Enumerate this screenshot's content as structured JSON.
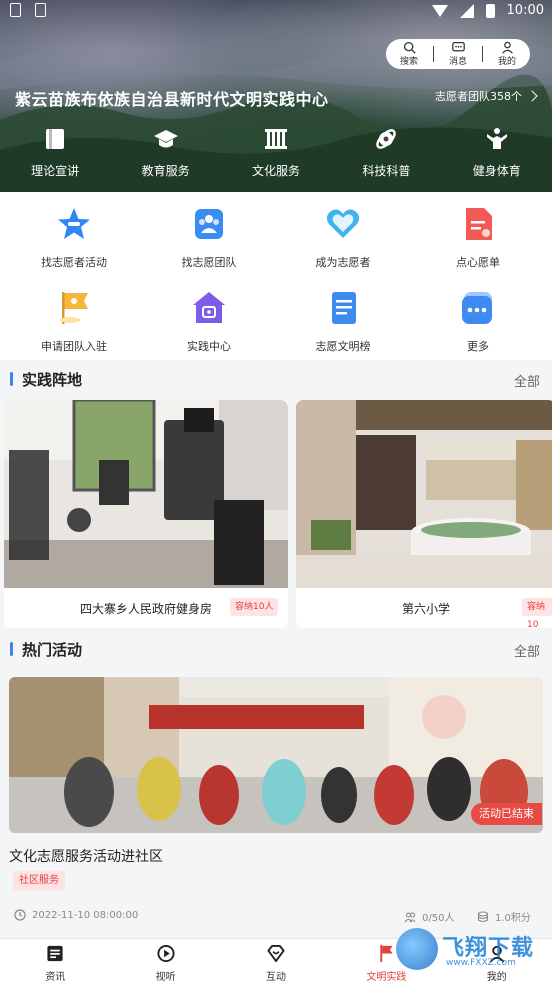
{
  "status": {
    "time": "10:00"
  },
  "top_actions": [
    {
      "icon": "search-icon",
      "label": "搜索"
    },
    {
      "icon": "message-icon",
      "label": "消息"
    },
    {
      "icon": "user-icon",
      "label": "我的"
    }
  ],
  "hero": {
    "title": "紫云苗族布依族自治县新时代文明实践中心",
    "team_count": "志愿者团队358个"
  },
  "categories": [
    {
      "icon": "book-icon",
      "label": "理论宣讲"
    },
    {
      "icon": "graduation-cap-icon",
      "label": "教育服务"
    },
    {
      "icon": "culture-building-icon",
      "label": "文化服务"
    },
    {
      "icon": "science-icon",
      "label": "科技科普"
    },
    {
      "icon": "fitness-icon",
      "label": "健身体育"
    }
  ],
  "quick_grid": [
    {
      "icon": "star-chat-icon",
      "label": "找志愿者活动",
      "color": "#2f86f6"
    },
    {
      "icon": "group-icon",
      "label": "找志愿团队",
      "color": "#3b8cf2"
    },
    {
      "icon": "heart-icon",
      "label": "成为志愿者",
      "color": "#41b3ee"
    },
    {
      "icon": "wish-doc-icon",
      "label": "点心愿单",
      "color": "#f25a55"
    },
    {
      "icon": "team-join-icon",
      "label": "申请团队入驻",
      "color": "#f5b73b"
    },
    {
      "icon": "practice-home-icon",
      "label": "实践中心",
      "color": "#7d5ce8"
    },
    {
      "icon": "ranking-doc-icon",
      "label": "志愿文明榜",
      "color": "#3d8af0"
    },
    {
      "icon": "more-icon",
      "label": "更多",
      "color": "#3d8af0"
    }
  ],
  "venues_section": {
    "title": "实践阵地",
    "all": "全部"
  },
  "venues": [
    {
      "name": "四大寨乡人民政府健身房",
      "capacity": "容纳10人"
    },
    {
      "name": "第六小学",
      "capacity": "容纳10"
    }
  ],
  "activities_section": {
    "title": "热门活动",
    "all": "全部"
  },
  "activity": {
    "status": "活动已结束",
    "title": "文化志愿服务活动进社区",
    "tag": "社区服务",
    "datetime": "2022-11-10 08:00:00",
    "participants": "0/50人",
    "points": "1.0积分"
  },
  "nav": [
    {
      "icon": "news-icon",
      "label": "资讯"
    },
    {
      "icon": "play-icon",
      "label": "视听"
    },
    {
      "icon": "interact-icon",
      "label": "互动"
    },
    {
      "icon": "practice-icon",
      "label": "文明实践",
      "active": true
    },
    {
      "icon": "profile-icon",
      "label": "我的"
    }
  ],
  "watermark": {
    "text": "飞翔下载",
    "url": "www.FXXZ.com"
  }
}
